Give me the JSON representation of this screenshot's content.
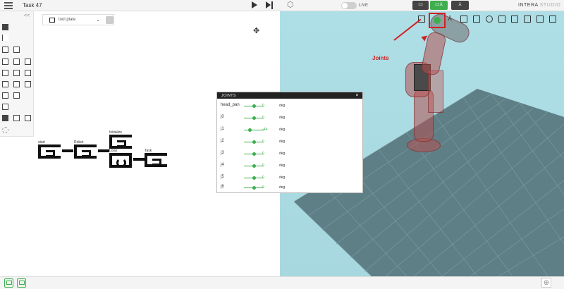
{
  "header": {
    "task_title": "Task 47",
    "live_label": "LIVE",
    "brand_main": "INTERA",
    "brand_sub": " STUDIO",
    "icons": [
      "menu-icon",
      "play-icon",
      "step-icon",
      "settings-hex-icon"
    ]
  },
  "view_buttons": [
    "task-view-icon",
    "split-view-icon",
    "robot-view-icon"
  ],
  "palette": {
    "collapse_label": "<<"
  },
  "task_toolbar": {
    "select_value": "tool plate"
  },
  "behavior_tree": {
    "nodes": [
      "start",
      "Robot",
      "Initialize",
      "Loop",
      "Task"
    ]
  },
  "viewport": {
    "annotation": "Joints",
    "annotation_color": "#d42020",
    "floor_color": "#5e7f86",
    "sky_color": "#aedee6"
  },
  "joints_panel": {
    "title": "JOINTS",
    "close_label": "×",
    "joints": [
      {
        "name": "head_pan",
        "value": "0",
        "unit": "deg"
      },
      {
        "name": "j0",
        "value": "0",
        "unit": "deg"
      },
      {
        "name": "j1",
        "value": "-44",
        "unit": "deg"
      },
      {
        "name": "j2",
        "value": "0",
        "unit": "deg"
      },
      {
        "name": "j3",
        "value": "0",
        "unit": "deg"
      },
      {
        "name": "j4",
        "value": "0",
        "unit": "deg"
      },
      {
        "name": "j5",
        "value": "0",
        "unit": "deg"
      },
      {
        "name": "j6",
        "value": "0",
        "unit": "deg"
      }
    ]
  },
  "accent_color": "#3fae4f"
}
